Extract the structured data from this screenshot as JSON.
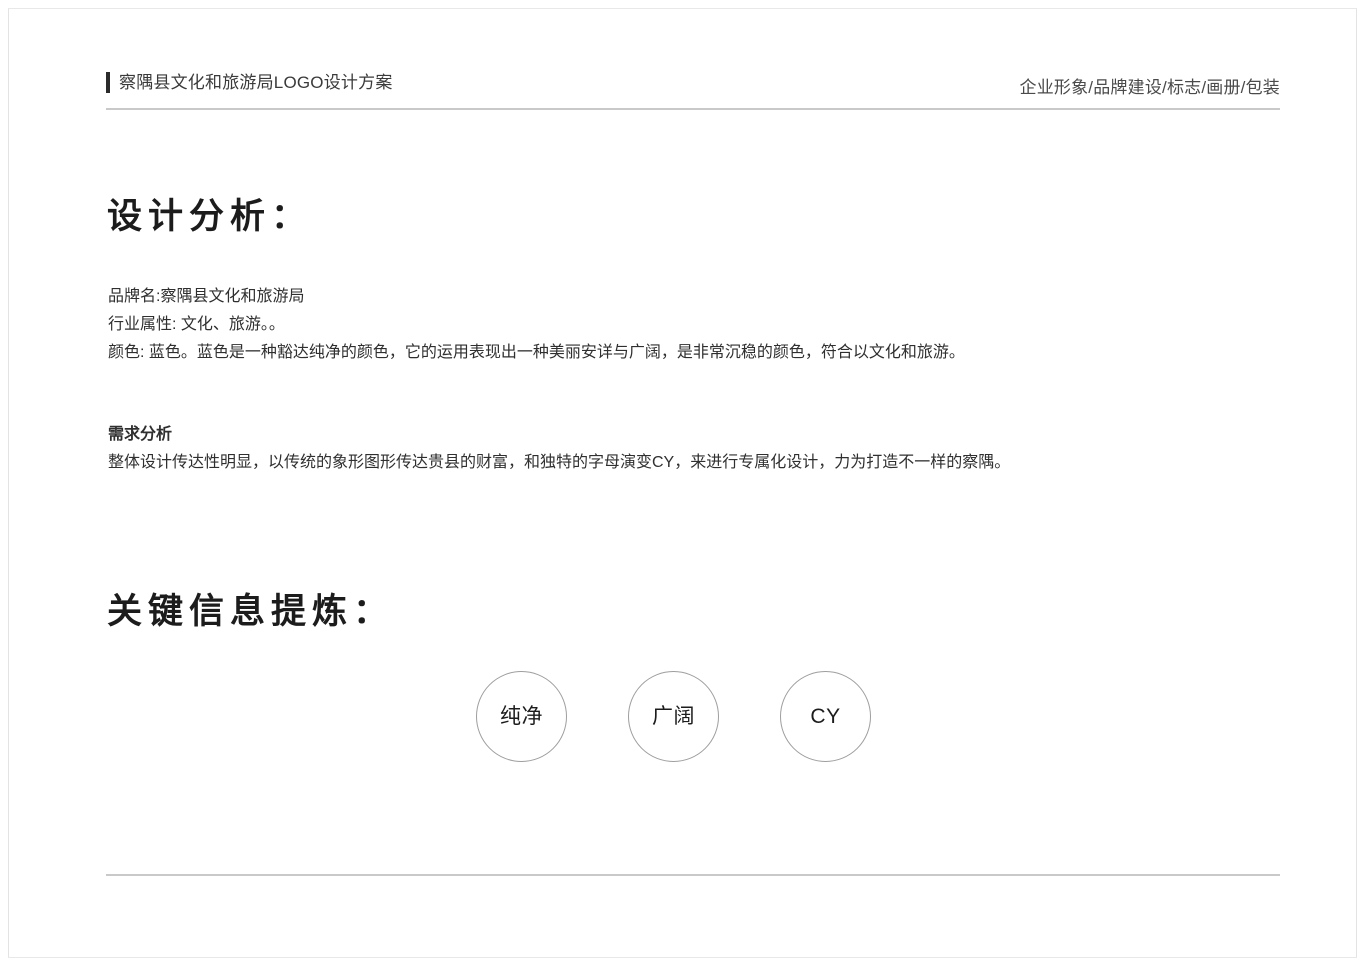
{
  "header": {
    "title": "察隅县文化和旅游局LOGO设计方案",
    "categories": "企业形象/品牌建设/标志/画册/包装"
  },
  "sections": {
    "design_analysis": {
      "heading": "设计分析：",
      "lines": [
        "品牌名:察隅县文化和旅游局",
        "行业属性: 文化、旅游。。",
        "颜色: 蓝色。蓝色是一种豁达纯净的颜色，它的运用表现出一种美丽安详与广阔，是非常沉稳的颜色，符合以文化和旅游。"
      ],
      "demand_heading": "需求分析",
      "demand_text": "整体设计传达性明显，以传统的象形图形传达贵县的财富，和独特的字母演变CY，来进行专属化设计，力为打造不一样的察隅。"
    },
    "key_info": {
      "heading": "关键信息提炼：",
      "keywords": [
        {
          "label": "纯净"
        },
        {
          "label": "广阔"
        },
        {
          "label": "CY"
        }
      ]
    }
  }
}
